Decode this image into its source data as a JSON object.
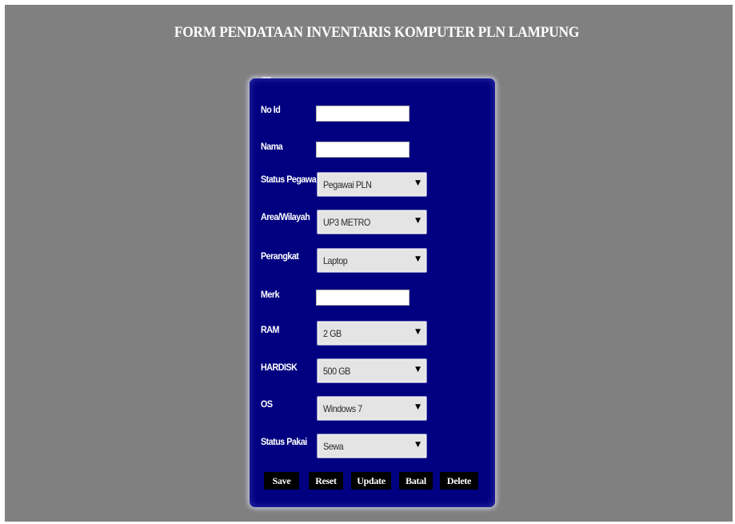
{
  "page": {
    "title": "FORM PENDATAAN INVENTARIS KOMPUTER PLN LAMPUNG"
  },
  "form": {
    "no_id": {
      "label": "No Id",
      "value": ""
    },
    "nama": {
      "label": "Nama",
      "value": ""
    },
    "status_pegawai": {
      "label": "Status Pegawai",
      "selected": "Pegawai PLN"
    },
    "area_wilayah": {
      "label": "Area/Wilayah",
      "selected": "UP3 METRO"
    },
    "perangkat": {
      "label": "Perangkat",
      "selected": "Laptop"
    },
    "merk": {
      "label": "Merk",
      "value": ""
    },
    "ram": {
      "label": "RAM",
      "selected": "2 GB"
    },
    "hardisk": {
      "label": "HARDISK",
      "selected": "500 GB"
    },
    "os": {
      "label": "OS",
      "selected": "Windows 7"
    },
    "status_pakai": {
      "label": "Status Pakai",
      "selected": "Sewa"
    }
  },
  "buttons": {
    "save": "Save",
    "reset": "Reset",
    "update": "Update",
    "batal": "Batal",
    "delete": "Delete"
  },
  "icons": {
    "dropdown_arrow": "chevron-down-icon"
  },
  "colors": {
    "page_background": "#808080",
    "panel_background": "#000080",
    "button_background": "#000000",
    "title_text": "#ffffff"
  }
}
